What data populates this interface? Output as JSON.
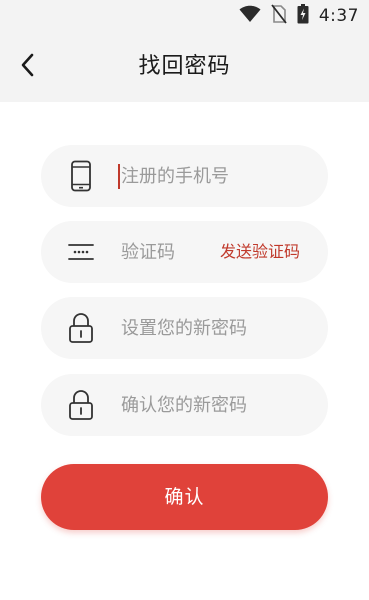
{
  "status_bar": {
    "time": "4:37",
    "icons": [
      "wifi-icon",
      "no-sim-icon",
      "battery-charging-icon"
    ]
  },
  "header": {
    "back_icon": "chevron-left-icon",
    "title": "找回密码"
  },
  "form": {
    "phone": {
      "icon": "phone-icon",
      "placeholder": "注册的手机号",
      "value": ""
    },
    "code": {
      "icon": "sms-code-icon",
      "placeholder": "验证码",
      "value": "",
      "send_label": "发送验证码"
    },
    "new_password": {
      "icon": "lock-icon",
      "placeholder": "设置您的新密码",
      "value": ""
    },
    "confirm_password": {
      "icon": "lock-icon",
      "placeholder": "确认您的新密码",
      "value": ""
    }
  },
  "confirm_button": {
    "label": "确认"
  },
  "colors": {
    "accent": "#e0423a",
    "accent_text": "#c0392b",
    "header_bg": "#f3f3f3",
    "field_bg": "#f6f6f6"
  }
}
